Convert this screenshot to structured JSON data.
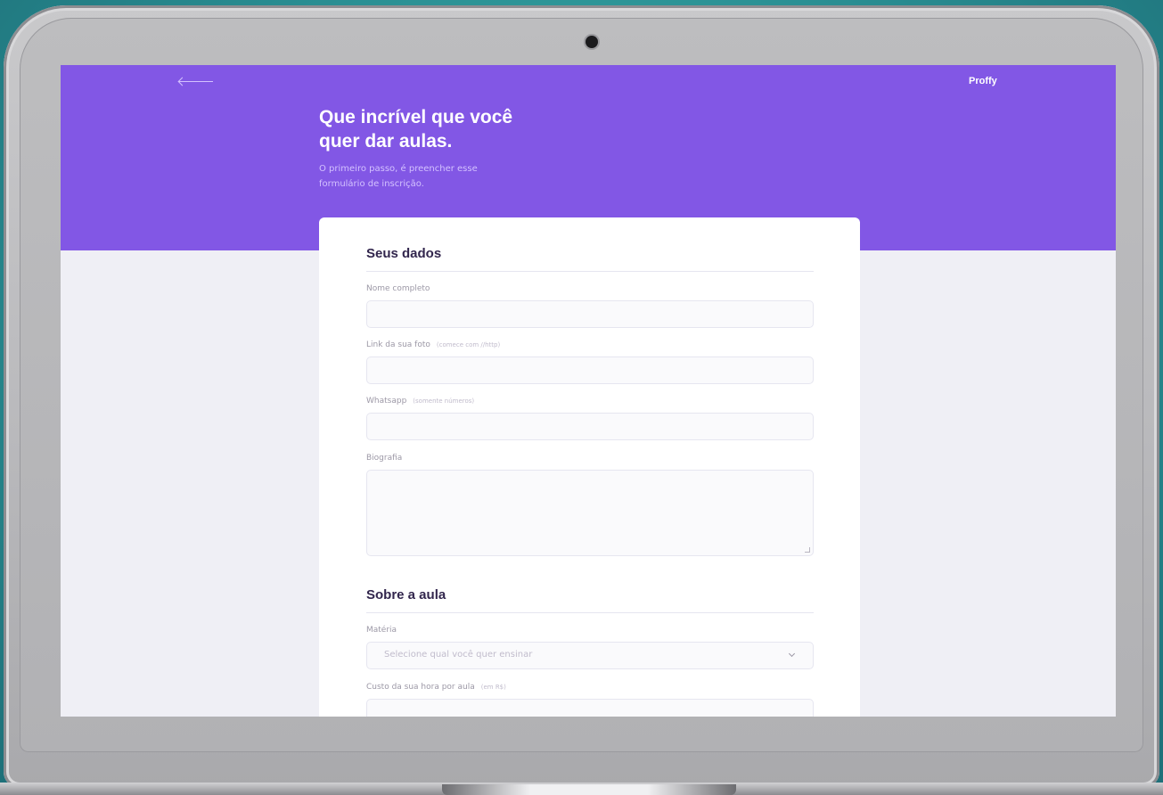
{
  "app": {
    "logo": "Proffy"
  },
  "header": {
    "title_line1": "Que incrível que você",
    "title_line2": "quer dar aulas.",
    "subtitle_line1": "O primeiro passo, é preencher esse",
    "subtitle_line2": "formulário de inscrição."
  },
  "form": {
    "section1": {
      "title": "Seus dados",
      "fields": {
        "name": {
          "label": "Nome completo",
          "value": ""
        },
        "avatar": {
          "label": "Link da sua foto",
          "hint": "(comece com //http)",
          "value": ""
        },
        "whatsapp": {
          "label": "Whatsapp",
          "hint": "(somente números)",
          "value": ""
        },
        "bio": {
          "label": "Biografia",
          "value": ""
        }
      }
    },
    "section2": {
      "title": "Sobre a aula",
      "fields": {
        "subject": {
          "label": "Matéria",
          "placeholder": "Selecione qual você quer ensinar"
        },
        "cost": {
          "label": "Custo da sua hora por aula",
          "hint": "(em R$)",
          "value": ""
        }
      }
    }
  },
  "colors": {
    "primary": "#8257e5",
    "background": "#efeff5",
    "title_text": "#32264d",
    "label_text": "#9c98a6"
  },
  "icons": {
    "back": "arrow-left-icon",
    "select": "chevron-down-icon"
  }
}
